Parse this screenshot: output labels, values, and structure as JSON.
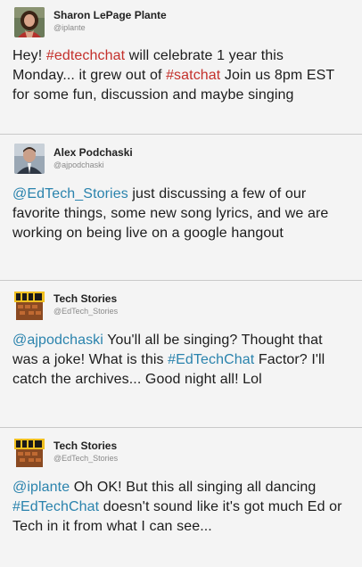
{
  "tweets": [
    {
      "name": "Sharon LePage Plante",
      "handle": "@iplante",
      "avatar": "woman-portrait",
      "parts": [
        {
          "t": "text",
          "v": "Hey! "
        },
        {
          "t": "hashtag",
          "v": "#edtechchat"
        },
        {
          "t": "text",
          "v": " will celebrate 1 year this Monday... it grew out of "
        },
        {
          "t": "hashtag",
          "v": "#satchat"
        },
        {
          "t": "text",
          "v": " Join us 8pm EST for some fun, discussion and maybe singing"
        }
      ]
    },
    {
      "name": "Alex Podchaski",
      "handle": "@ajpodchaski",
      "avatar": "man-portrait",
      "parts": [
        {
          "t": "mention",
          "v": "@EdTech_Stories"
        },
        {
          "t": "text",
          "v": " just discussing a few of our favorite things, some new song lyrics, and we are working on being live on a google hangout"
        }
      ]
    },
    {
      "name": "Tech Stories",
      "handle": "@EdTech_Stories",
      "avatar": "tech-stories-logo",
      "parts": [
        {
          "t": "mention",
          "v": "@ajpodchaski"
        },
        {
          "t": "text",
          "v": " You'll all be singing? Thought that was a joke! What is this "
        },
        {
          "t": "mention",
          "v": "#EdTechChat"
        },
        {
          "t": "text",
          "v": " Factor? I'll catch the archives... Good night all! Lol"
        }
      ]
    },
    {
      "name": "Tech Stories",
      "handle": "@EdTech_Stories",
      "avatar": "tech-stories-logo",
      "parts": [
        {
          "t": "mention",
          "v": "@iplante"
        },
        {
          "t": "text",
          "v": " Oh OK! But this all singing all dancing "
        },
        {
          "t": "mention",
          "v": "#EdTechChat"
        },
        {
          "t": "text",
          "v": " doesn't sound like it's got much Ed or Tech in it from what I can see..."
        }
      ]
    }
  ],
  "colors": {
    "hashtag": "#c4302b",
    "mention": "#2a83ad",
    "background": "#f4f4f4"
  }
}
